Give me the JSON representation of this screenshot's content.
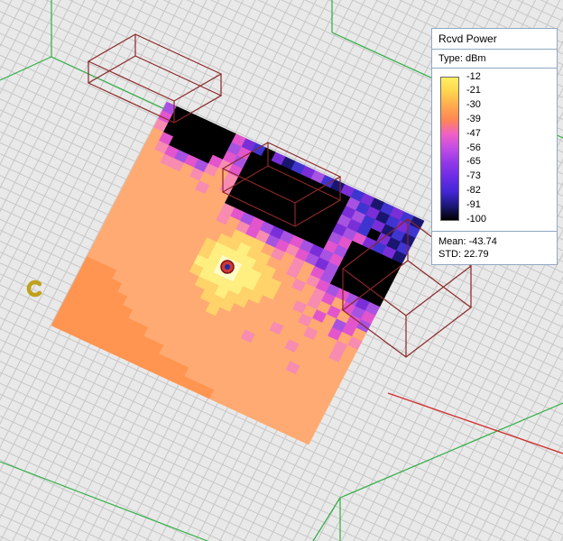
{
  "legend": {
    "title": "Rcvd Power",
    "type_label": "Type: dBm",
    "ticks": [
      "-12",
      "-21",
      "-30",
      "-39",
      "-47",
      "-56",
      "-65",
      "-73",
      "-82",
      "-91",
      "-100"
    ],
    "mean_label": "Mean: -43.74",
    "std_label": "STD: 22.79",
    "gradient": [
      "#ffef62",
      "#ffd44e",
      "#ffaa4e",
      "#ff8456",
      "#ef5fc8",
      "#c04ce6",
      "#9138e8",
      "#6a2ce4",
      "#4426d8",
      "#1c1878",
      "#000000"
    ]
  },
  "colors": {
    "background": "#e9e9e9",
    "grid_line": "#c7c7c7",
    "boundary_green": "#2fae44",
    "axis_red": "#d22b2b",
    "wireframe": "#8b2626",
    "tx_outer": "#cf3838",
    "tx_ring": "#7a1010",
    "tx_inner": "#1f2e9e",
    "rx_arc": "#bfa11c"
  },
  "chart_data": {
    "type": "heatmap",
    "title": "Rcvd Power",
    "units": "dBm",
    "colorbar_ticks": [
      -12,
      -21,
      -30,
      -39,
      -47,
      -56,
      -65,
      -73,
      -82,
      -91,
      -100
    ],
    "mean_dbm": -43.74,
    "std_dbm": 22.79,
    "grid_rows": 26,
    "grid_cols": 26,
    "palette": {
      "K": "#000000",
      "D": "#1a1670",
      "B": "#4034d0",
      "V": "#7a2ed8",
      "P": "#a852e2",
      "M": "#e255cc",
      "m": "#f78bb0",
      "o": "#ffaa72",
      "O": "#ff9550",
      "y": "#ffd26a",
      "Y": "#ffee80",
      "W": "#fffcc8"
    },
    "palette_dbm": {
      "K": -100,
      "D": -91,
      "B": -82,
      "V": -73,
      "P": -65,
      "M": -56,
      "m": -48,
      "o": -40,
      "O": -44,
      "y": -31,
      "Y": -22,
      "W": -13
    },
    "rows": [
      "PKKKKKKMVBKVDBVPBDVBVDBVBD",
      "MKKKKKKPMKKKKKKKKKKPBVDBVB",
      "mKKKKKKMPKKKKKKKKKKVPBVDBD",
      "oMKKKKMmMKKKKKKKKKKPVBKVDB",
      "omMPMPmomKKKKKKKKKKVPMVBVD",
      "oommomoomKKKKKKKKKKPMKKKKK",
      "oooooomooKKKKKKKKKKMPKKKKK",
      "ooooooooomMPMPVPMPVPMKKKKK",
      "ooooooooomomMmPMmMPVPKKKKK",
      "oooooooooooyyyomomoMPKKKKK",
      "ooooooooooyyYyyoomomMPMPVP",
      "oooooooooyYYYYyyoomomMoMPM",
      "oooooooooyYWWYYyyooomoMoMP",
      "oooooooooYYWWYYyyoomoMoPMo",
      "oooooooooyYYYYyyoooomooMom",
      "ooooooooooyyYyyoooooomoomo",
      "oooooooooooyyyoooomooooomo",
      "ooooooooooooyooooooomooooo",
      "OOOooooooooooooomooooooooo",
      "OOOOooooooooooooooooomoooo",
      "OOOOOooooooooooooooooooooo",
      "OOOOOOoooooooooooooooooooo",
      "OOOOOOOOoooooooooooooooooo",
      "OOOOOOOOOOoooooooooooooooo",
      "OOOOOOOOOOOOOooooooooooooo",
      "OOOOOOOOOOOOOOOOoooooooooo"
    ]
  }
}
